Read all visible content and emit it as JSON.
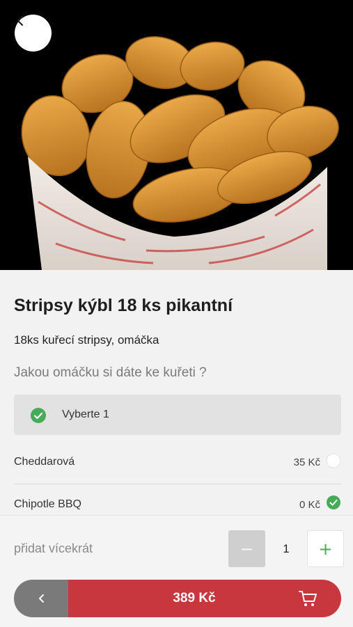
{
  "product": {
    "title": "Stripsy kýbl 18 ks pikantní",
    "description": "18ks kuřecí stripsy, omáčka",
    "question": "Jakou omáčku si dáte ke kuřeti ?",
    "requirement": "Vyberte 1",
    "options": [
      {
        "name": "Cheddarová",
        "price": "35 Kč",
        "selected": false
      },
      {
        "name": "Chipotle BBQ",
        "price": "0 Kč",
        "selected": true
      }
    ]
  },
  "quantity": {
    "label": "přidat vícekrát",
    "minus": "−",
    "value": "1",
    "plus": "+"
  },
  "footer": {
    "total": "389 Kč"
  },
  "icons": {
    "back": "chevron-left-icon",
    "check": "check-circle-icon",
    "cart": "cart-icon"
  },
  "colors": {
    "accent_red": "#c8373d",
    "check_green": "#46ab58",
    "back_gray": "#7a7a7a"
  }
}
